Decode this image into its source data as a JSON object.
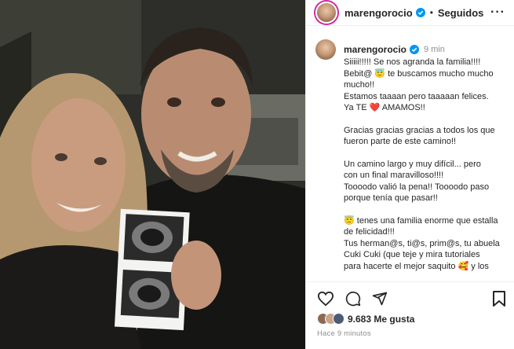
{
  "header": {
    "username": "marengorocio",
    "separator": "•",
    "follow_status": "Seguidos",
    "more_label": "···"
  },
  "caption": {
    "username": "marengorocio",
    "time": "9 min",
    "line1": "Siiiii!!!!! Se nos agranda la familia!!!!",
    "line2_a": "Bebit@",
    "line2_b": "te buscamos mucho mucho",
    "line3": "mucho!!",
    "line4": "Estamos taaaan pero taaaaan felices.",
    "line5_a": "Ya TE",
    "line5_b": "AMAMOS!!",
    "line6": "Gracias gracias gracias a todos los que",
    "line7": "fueron parte de este camino!!",
    "line8": "Un camino largo y muy difícil... pero",
    "line9": "con un final maravilloso!!!!",
    "line10": "Toooodo valió la pena!! Toooodo paso",
    "line11": "porque tenía que pasar!!",
    "line12": "tenes una familia enorme que estalla",
    "line13": "de felicidad!!!",
    "line14": "Tus herman@s, ti@s, prim@s, tu abuela",
    "line15": "Cuki Cuki (que teje y mira tutoriales",
    "line16_a": "para hacerte el mejor saquito",
    "line16_b": "y los",
    "emoji_angel": "😇",
    "emoji_heart": "❤️",
    "emoji_hug": "🥰"
  },
  "actions": {
    "likes": "9.683 Me gusta",
    "ago": "Hace 9 minutos"
  },
  "colors": {
    "verified": "#0095f6",
    "heart": "#ed4956",
    "muted": "#8e8e8e"
  }
}
